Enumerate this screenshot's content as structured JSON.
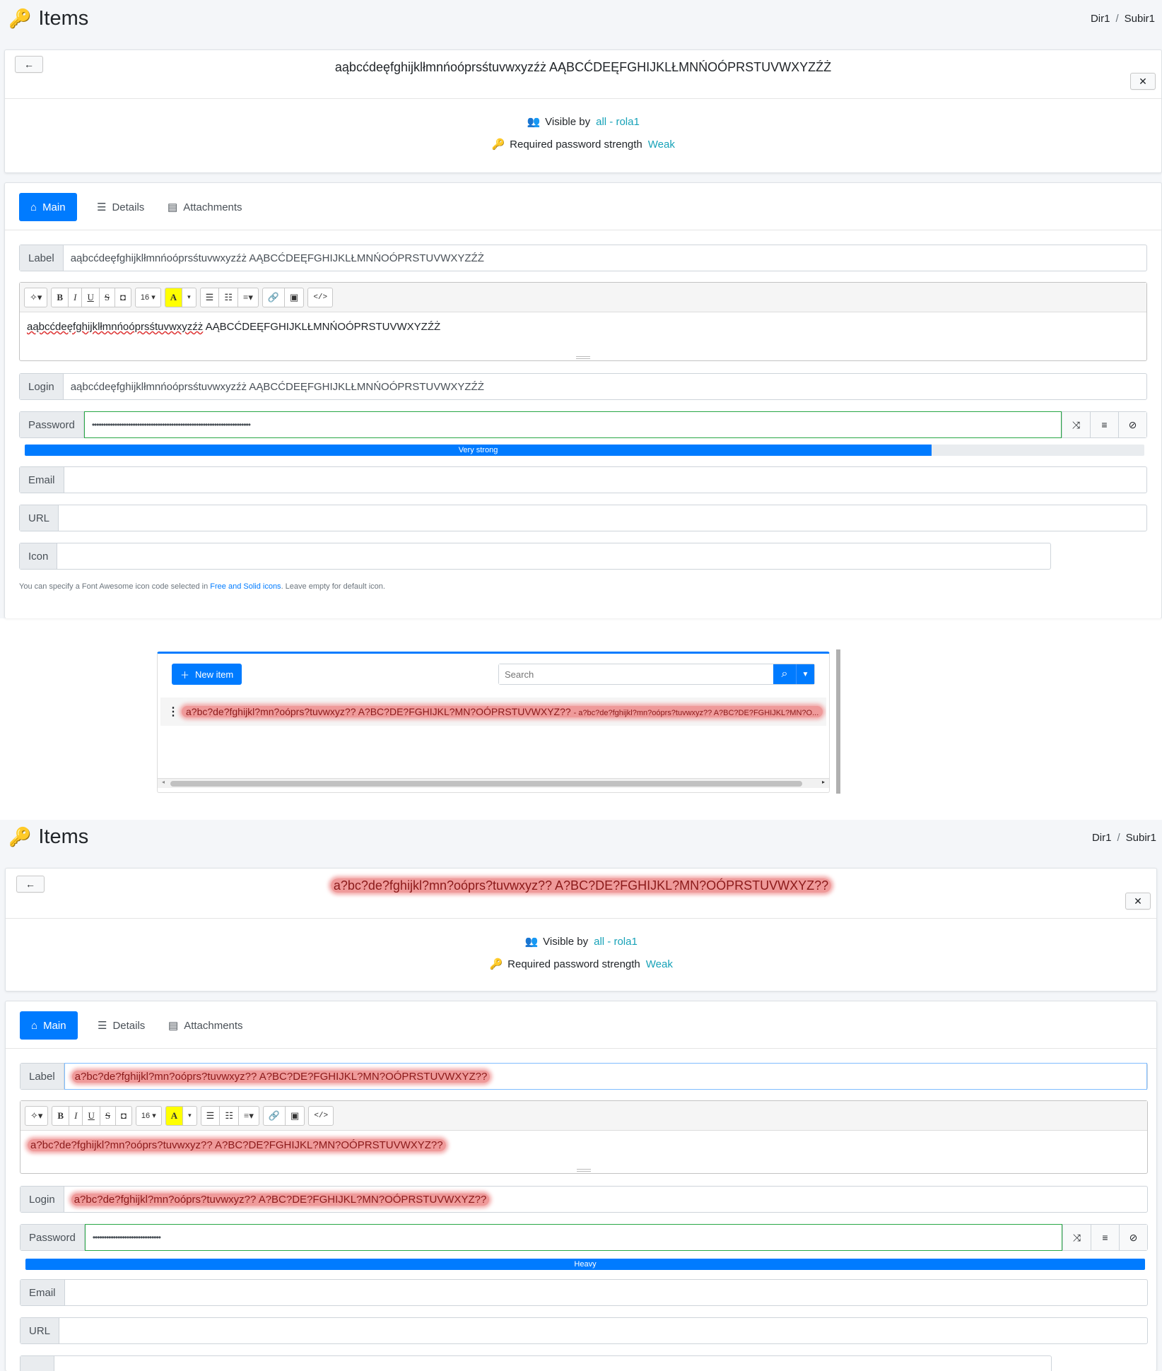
{
  "page_title": "Items",
  "breadcrumb": [
    "Dir1",
    "Subir1"
  ],
  "screen1": {
    "header_title": "aąbcćdeęfghijklłmnńoóprsśtuvwxyzźż AĄBCĆDEĘFGHIJKLŁMNŃOÓPRSTUVWXYZŹŻ",
    "visible_by_label": "Visible by",
    "visible_by_value": "all - rola1",
    "pwd_strength_label": "Required password strength",
    "pwd_strength_value": "Weak",
    "tabs": [
      "Main",
      "Details",
      "Attachments"
    ],
    "label_field": {
      "label": "Label",
      "value": "aąbcćdeęfghijklłmnńoóprsśtuvwxyzźż AĄBCĆDEĘFGHIJKLŁMNŃOÓPRSTUVWXYZŹŻ"
    },
    "editor_text_1": "aąbcćdeęfghijklłmnńoóprsśtuvwxyzźż",
    "editor_text_2": "AĄBCĆDEĘFGHIJKLŁMNŃOÓPRSTUVWXYZŹŻ",
    "font_size": "16",
    "login_field": {
      "label": "Login",
      "value": "aąbcćdeęfghijklłmnńoóprsśtuvwxyzźż AĄBCĆDEĘFGHIJKLŁMNŃOÓPRSTUVWXYZŹŻ"
    },
    "password_field": {
      "label": "Password",
      "value": "••••••••••••••••••••••••••••••••••••••••••••••••••••••••••••••••••••••"
    },
    "strength_label": "Very strong",
    "strength_fraction": 0.81,
    "email_label": "Email",
    "url_label": "URL",
    "icon_label": "Icon",
    "hint_prefix": "You can specify a Font Awesome icon code selected in ",
    "hint_link": "Free and Solid icons",
    "hint_suffix": ". Leave empty for default icon."
  },
  "popup": {
    "new_item": "New item",
    "search_placeholder": "Search",
    "row_main": "a?bc?de?fghijkl?mn?oóprs?tuvwxyz?? A?BC?DE?FGHIJKL?MN?OÓPRSTUVWXYZ??",
    "row_sub": "- a?bc?de?fghijkl?mn?oóprs?tuvwxyz?? A?BC?DE?FGHIJKL?MN?O..."
  },
  "screen2": {
    "header_title": "a?bc?de?fghijkl?mn?oóprs?tuvwxyz?? A?BC?DE?FGHIJKL?MN?OÓPRSTUVWXYZ??",
    "visible_by_label": "Visible by",
    "visible_by_value": "all - rola1",
    "pwd_strength_label": "Required password strength",
    "pwd_strength_value": "Weak",
    "tabs": [
      "Main",
      "Details",
      "Attachments"
    ],
    "label_field": {
      "label": "Label",
      "value": "a?bc?de?fghijkl?mn?oóprs?tuvwxyz?? A?BC?DE?FGHIJKL?MN?OÓPRSTUVWXYZ??"
    },
    "editor_text": "a?bc?de?fghijkl?mn?oóprs?tuvwxyz?? A?BC?DE?FGHIJKL?MN?OÓPRSTUVWXYZ??",
    "font_size": "16",
    "login_field": {
      "label": "Login",
      "value": "a?bc?de?fghijkl?mn?oóprs?tuvwxyz?? A?BC?DE?FGHIJKL?MN?OÓPRSTUVWXYZ??"
    },
    "password_field": {
      "label": "Password",
      "value": "••••••••••••••••••••••••••••••"
    },
    "strength_label": "Heavy",
    "strength_fraction": 1.0,
    "email_label": "Email",
    "url_label": "URL"
  }
}
